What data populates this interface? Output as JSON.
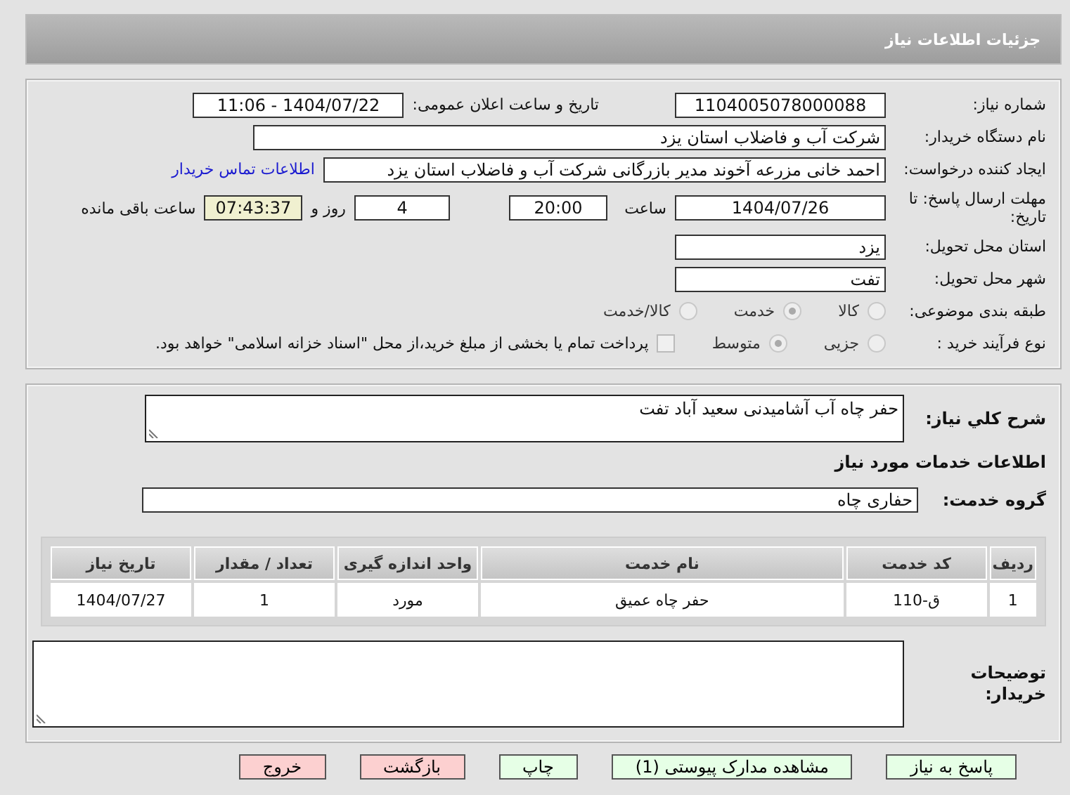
{
  "header": {
    "title": "جزئیات اطلاعات نیاز"
  },
  "need_number": {
    "label": "شماره نیاز:",
    "value": "1104005078000088"
  },
  "announce": {
    "label": "تاریخ و ساعت اعلان عمومی:",
    "value": "1404/07/22 - 11:06"
  },
  "buyer_org": {
    "label": "نام دستگاه خریدار:",
    "value": "شرکت آب و فاضلاب استان یزد"
  },
  "requester": {
    "label": "ایجاد کننده درخواست:",
    "value": "احمد خانی مزرعه آخوند مدیر بازرگانی شرکت آب و فاضلاب استان یزد",
    "link": "اطلاعات تماس خریدار"
  },
  "deadline": {
    "label": "مهلت ارسال پاسخ: تا تاریخ:",
    "date": "1404/07/26",
    "time_label": "ساعت",
    "time": "20:00",
    "days": "4",
    "days_label": "روز و",
    "remaining": "07:43:37",
    "remaining_label": "ساعت باقی مانده"
  },
  "province": {
    "label": "استان محل تحویل:",
    "value": "یزد"
  },
  "city": {
    "label": "شهر محل تحویل:",
    "value": "تفت"
  },
  "category": {
    "label": "طبقه بندی موضوعی:",
    "options": [
      {
        "label": "کالا",
        "selected": false
      },
      {
        "label": "خدمت",
        "selected": true
      },
      {
        "label": "کالا/خدمت",
        "selected": false
      }
    ]
  },
  "process": {
    "label": "نوع فرآیند خرید :",
    "options": [
      {
        "label": "جزیی",
        "selected": false
      },
      {
        "label": "متوسط",
        "selected": true
      }
    ],
    "treasury": {
      "label": "پرداخت تمام یا بخشی از مبلغ خرید،از محل \"اسناد خزانه اسلامی\" خواهد بود.",
      "checked": false
    }
  },
  "description": {
    "label": "شرح کلي نياز:",
    "value": "حفر چاه آب آشامیدنی سعید آباد تفت"
  },
  "services_heading": "اطلاعات خدمات مورد نياز",
  "service_group": {
    "label": "گروه خدمت:",
    "value": "حفاری چاه"
  },
  "table": {
    "columns": [
      "ردیف",
      "کد خدمت",
      "نام خدمت",
      "واحد اندازه گیری",
      "تعداد / مقدار",
      "تاریخ نیاز"
    ],
    "rows": [
      [
        "1",
        "ق-110",
        "حفر چاه عمیق",
        "مورد",
        "1",
        "1404/07/27"
      ]
    ]
  },
  "buyer_notes": {
    "label": "توضیحات خریدار:"
  },
  "buttons": [
    {
      "label": "پاسخ به نیاز",
      "kind": "normal"
    },
    {
      "label": "مشاهده مدارک پیوستی (1)",
      "kind": "normal"
    },
    {
      "label": "چاپ",
      "kind": "normal"
    },
    {
      "label": "بازگشت",
      "kind": "danger"
    },
    {
      "label": "خروج",
      "kind": "danger"
    }
  ]
}
